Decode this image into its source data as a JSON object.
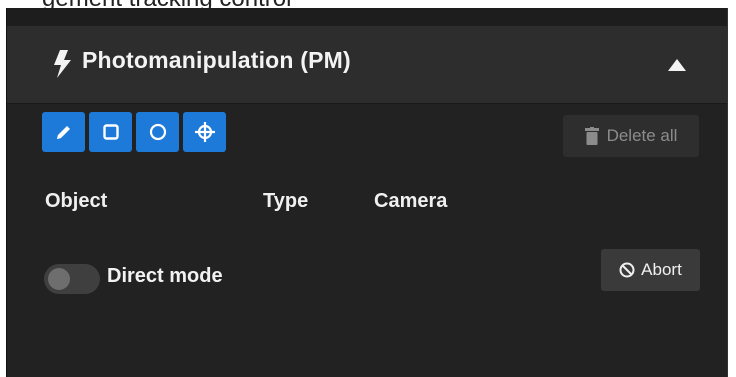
{
  "top_strip": {
    "text": "gement    tracking    control"
  },
  "header": {
    "title": "Photomanipulation (PM)"
  },
  "toolbar": {
    "tools": [
      "pencil-icon",
      "square-icon",
      "circle-icon",
      "crosshair-icon"
    ],
    "delete_all_label": "Delete all"
  },
  "table": {
    "columns": [
      "Object",
      "Type",
      "Camera"
    ]
  },
  "direct_mode": {
    "label": "Direct mode",
    "enabled": false
  },
  "abort": {
    "label": "Abort"
  },
  "colors": {
    "panel_bg": "#222222",
    "header_bg": "#2d2d2d",
    "tool_blue": "#1d7ad9",
    "text": "#f0f0f0",
    "muted_text": "#8c8c8c"
  }
}
